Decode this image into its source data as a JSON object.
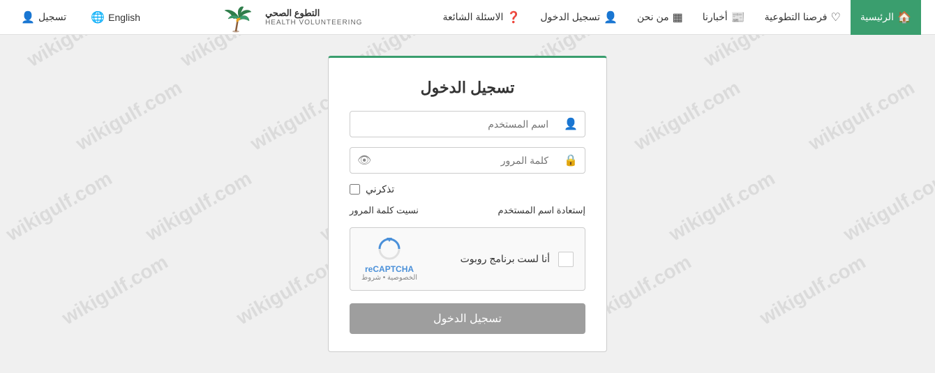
{
  "nav": {
    "items": [
      {
        "id": "home",
        "label": "الرئيسية",
        "icon": "🏠",
        "active": true
      },
      {
        "id": "opportunities",
        "label": "فرصنا التطوعية",
        "icon": "♡",
        "active": false
      },
      {
        "id": "news",
        "label": "أخبارنا",
        "icon": "📰",
        "active": false
      },
      {
        "id": "about",
        "label": "من نحن",
        "icon": "▦",
        "active": false
      },
      {
        "id": "register",
        "label": "تسجيل الدخول",
        "icon": "👤",
        "active": false
      },
      {
        "id": "faq",
        "label": "الاسئلة الشائعة",
        "icon": "❓",
        "active": false
      }
    ],
    "lang_label": "English",
    "lang_icon": "🌐",
    "user_label": "تسجيل",
    "user_icon": "👤"
  },
  "logo": {
    "alt": "Health Volunteering",
    "text": "التطوع الصحي",
    "sub": "HEALTH VOLUNTEERING"
  },
  "login": {
    "title": "تسجيل الدخول",
    "username_placeholder": "اسم المستخدم",
    "password_placeholder": "كلمة المرور",
    "remember_label": "تذكرني",
    "forgot_password": "نسيت كلمة المرور",
    "forgot_username": "إستعادة اسم المستخدم",
    "captcha_label": "أنا لست برنامج روبوت",
    "captcha_brand": "reCAPTCHA",
    "captcha_privacy": "الخصوصية • شروط",
    "submit_label": "تسجيل الدخول"
  },
  "watermark": {
    "text": "wikigulf.com"
  }
}
